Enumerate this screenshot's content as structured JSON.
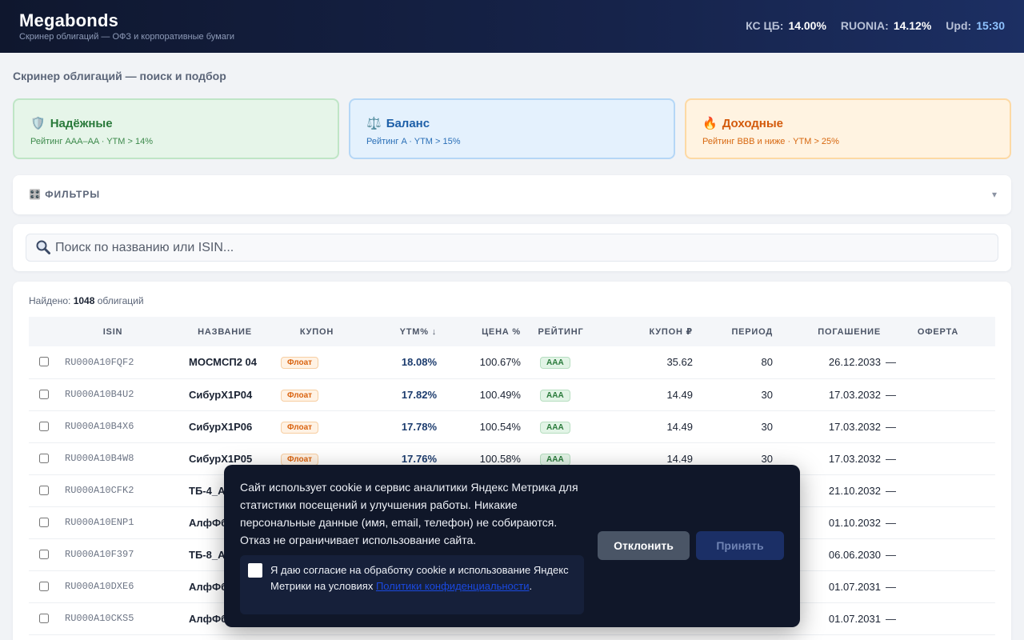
{
  "header": {
    "brand": "Megabonds",
    "subtitle": "Скринер облигаций — ОФЗ и корпоративные бумаги",
    "rates": [
      {
        "label": "КС ЦБ:",
        "value": "14.00%"
      },
      {
        "label": "RUONIA:",
        "value": "14.12%"
      },
      {
        "label": "Upd:",
        "value": "15:30"
      }
    ]
  },
  "page_title": "Скринер облигаций — поиск и подбор",
  "presets": [
    {
      "icon": "🛡️",
      "icon_name": "shield-icon",
      "title": "Надёжные",
      "subtitle": "Рейтинг AAA–AA · YTM > 14%",
      "color": "#2a7a3b"
    },
    {
      "icon": "⚖️",
      "icon_name": "scales-icon",
      "title": "Баланс",
      "subtitle": "Рейтинг A · YTM > 15%",
      "color": "#1d5fa8"
    },
    {
      "icon": "🔥",
      "icon_name": "fire-icon",
      "title": "Доходные",
      "subtitle": "Рейтинг BBB и ниже · YTM > 25%",
      "color": "#d35a0c"
    }
  ],
  "filters": {
    "icon": "🎛️",
    "label": "ФИЛЬТРЫ",
    "caret": "▾"
  },
  "search": {
    "placeholder": "Поиск по названию или ISIN..."
  },
  "results": {
    "found_label": "Найдено:",
    "found_count": "1048",
    "found_suffix": "облигаций",
    "columns": [
      "",
      "ISIN",
      "НАЗВАНИЕ",
      "КУПОН",
      "YTM% ↓",
      "ЦЕНА %",
      "РЕЙТИНГ",
      "КУПОН ₽",
      "ПЕРИОД",
      "ПОГАШЕНИЕ",
      "ОФЕРТА"
    ],
    "rows": [
      {
        "isin": "RU000A10FQF2",
        "name": "МОСМСП2 04",
        "coupon_type": "Флоат",
        "ytm": "18.08%",
        "price": "100.67%",
        "rating": "AAA",
        "coupon_rub": "35.62",
        "period": "80",
        "maturity": "26.12.2033",
        "offer": "—"
      },
      {
        "isin": "RU000A10B4U2",
        "name": "СибурХ1Р04",
        "coupon_type": "Флоат",
        "ytm": "17.82%",
        "price": "100.49%",
        "rating": "AAA",
        "coupon_rub": "14.49",
        "period": "30",
        "maturity": "17.03.2032",
        "offer": "—"
      },
      {
        "isin": "RU000A10B4X6",
        "name": "СибурХ1Р06",
        "coupon_type": "Флоат",
        "ytm": "17.78%",
        "price": "100.54%",
        "rating": "AAA",
        "coupon_rub": "14.49",
        "period": "30",
        "maturity": "17.03.2032",
        "offer": "—"
      },
      {
        "isin": "RU000A10B4W8",
        "name": "СибурХ1Р05",
        "coupon_type": "Флоат",
        "ytm": "17.76%",
        "price": "100.58%",
        "rating": "AAA",
        "coupon_rub": "14.49",
        "period": "30",
        "maturity": "17.03.2032",
        "offer": "—"
      },
      {
        "isin": "RU000A10CFK2",
        "name": "ТБ-4_А",
        "maturity": "21.10.2032",
        "offer": "—"
      },
      {
        "isin": "RU000A10ENP1",
        "name": "АлфФб",
        "maturity": "01.10.2032",
        "offer": "—"
      },
      {
        "isin": "RU000A10F397",
        "name": "ТБ-8_А",
        "maturity": "06.06.2030",
        "offer": "—"
      },
      {
        "isin": "RU000A10DXE6",
        "name": "АлфФб",
        "maturity": "01.07.2031",
        "offer": "—"
      },
      {
        "isin": "RU000A10CKS5",
        "name": "АлфФб",
        "maturity": "01.07.2031",
        "offer": "—"
      }
    ]
  },
  "cookie": {
    "text": "Сайт использует cookie и сервис аналитики Яндекс Метрика для статистики посещений и улучшения работы. Никакие персональные данные (имя, email, телефон) не собираются. Отказ не ограничивает использование сайта.",
    "consent_text": "Я даю согласие на обработку cookie и использование Яндекс Метрики на условиях",
    "consent_link": "Политики конфиденциальности",
    "consent_end": ".",
    "decline": "Отклонить",
    "accept": "Принять"
  }
}
